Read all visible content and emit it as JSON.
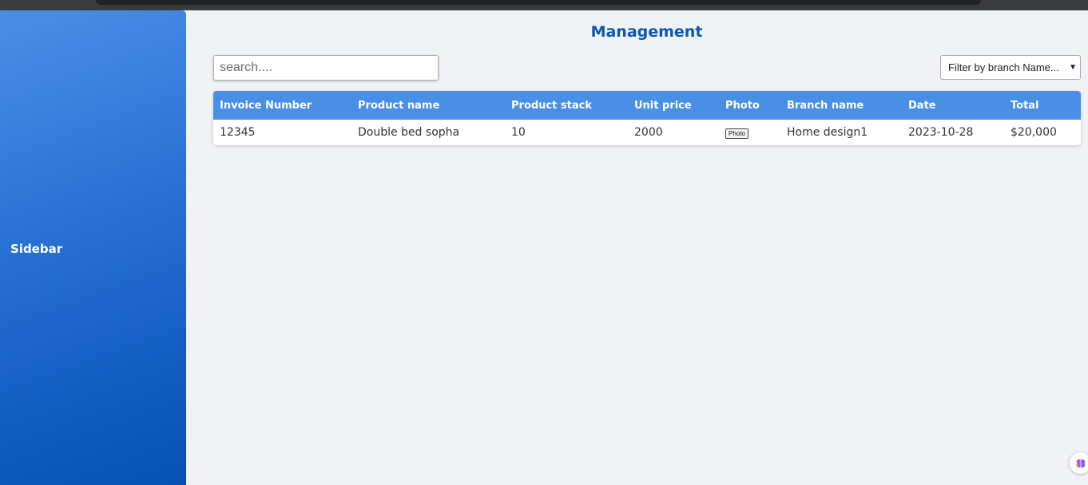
{
  "sidebar": {
    "label": "Sidebar"
  },
  "main": {
    "title": "Management",
    "search": {
      "placeholder": "search....",
      "value": ""
    },
    "branch_filter": {
      "selected": "Filter by branch Name..."
    },
    "table": {
      "headers": [
        "Invoice Number",
        "Product name",
        "Product stack",
        "Unit price",
        "Photo",
        "Branch name",
        "Date",
        "Total"
      ],
      "rows": [
        {
          "invoice": "12345",
          "product": "Double bed sopha",
          "stack": "10",
          "unit_price": "2000",
          "photo_label": "Photo",
          "branch": "Home design1",
          "date": "2023-10-28",
          "total": "$20,000"
        }
      ]
    }
  },
  "colors": {
    "accent": "#4a8fe6",
    "title": "#0a57b0",
    "sidebar_dark": "#0651b3"
  },
  "icons": {
    "chevron": "chevron-down-icon",
    "floating": "brain-icon"
  }
}
